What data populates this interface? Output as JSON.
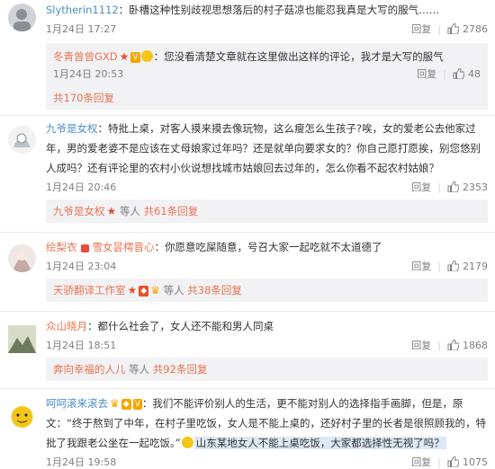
{
  "comments": [
    {
      "user": "Slytherin1112",
      "text": "：卧槽这种性别歧视思想落后的村子菇凉也能忍我真是大写的服气……",
      "time": "1月24日 17:27",
      "reply_label": "回复",
      "likes": "2786",
      "subreply": {
        "user": "冬青曾曾GXD",
        "text": "：您没看清楚文章就在这里做出这样的评论，我才是大写的服气",
        "time": "1月24日 20:53",
        "reply_label": "回复",
        "likes": "48"
      },
      "reply_count": "共170条回复"
    },
    {
      "user": "九爷是女权",
      "text": "：特批上桌，对客人摸来摸去像玩物，这么瘦怎么生孩子?唉，女的爱老公去他家过年，男的爱老婆不是应该在丈母娘家过年吗？还是就单向要求女的？你自己愿打愿挨，别您悠别人成吗？还有评论里的农村小伙说想找城市姑娘回去过年的，怎么你看不起农村姑娘？",
      "time": "1月24日 20:46",
      "reply_label": "回复",
      "likes": "2353",
      "reply_user": "九爷是女权",
      "reply_mid": " 等人 ",
      "reply_count": "共61条回复"
    },
    {
      "user": "绘梨衣",
      "user2": "雪女昙樗晋心",
      "text": "：你愿意吃屎随意，号召大家一起吃就不太道德了",
      "time": "1月24日 23:04",
      "reply_label": "回复",
      "likes": "2179",
      "reply_user": "天骄翻译工作室",
      "reply_mid": " 等人 ",
      "reply_count": "共38条回复"
    },
    {
      "user": "众山晓月",
      "text": "：都什么社会了，女人还不能和男人同桌",
      "time": "1月24日 18:51",
      "reply_label": "回复",
      "likes": "1868",
      "reply_user": "奔向幸福的人儿",
      "reply_mid": " 等人 ",
      "reply_count": "共92条回复"
    },
    {
      "user": "呵呵滚来滚去",
      "text": "：我们不能评价别人的生活，更不能对别人的选择指手画脚，但是，原文：“终于熬到了中年，在村子里吃饭，女人是不能上桌的，还好村子里的长者是很照顾我的，特批了我跟老公坐在一起吃饭。”",
      "text_tail": "山东某地女人不能上桌吃饭，大家都选择性无视了吗？",
      "time": "1月24日 19:58",
      "reply_label": "回复",
      "likes": "1075"
    }
  ],
  "badges": {
    "vip": "V"
  },
  "colors": {
    "accent": "#eb7350",
    "link": "#4c8dc9",
    "meta": "#808080"
  }
}
